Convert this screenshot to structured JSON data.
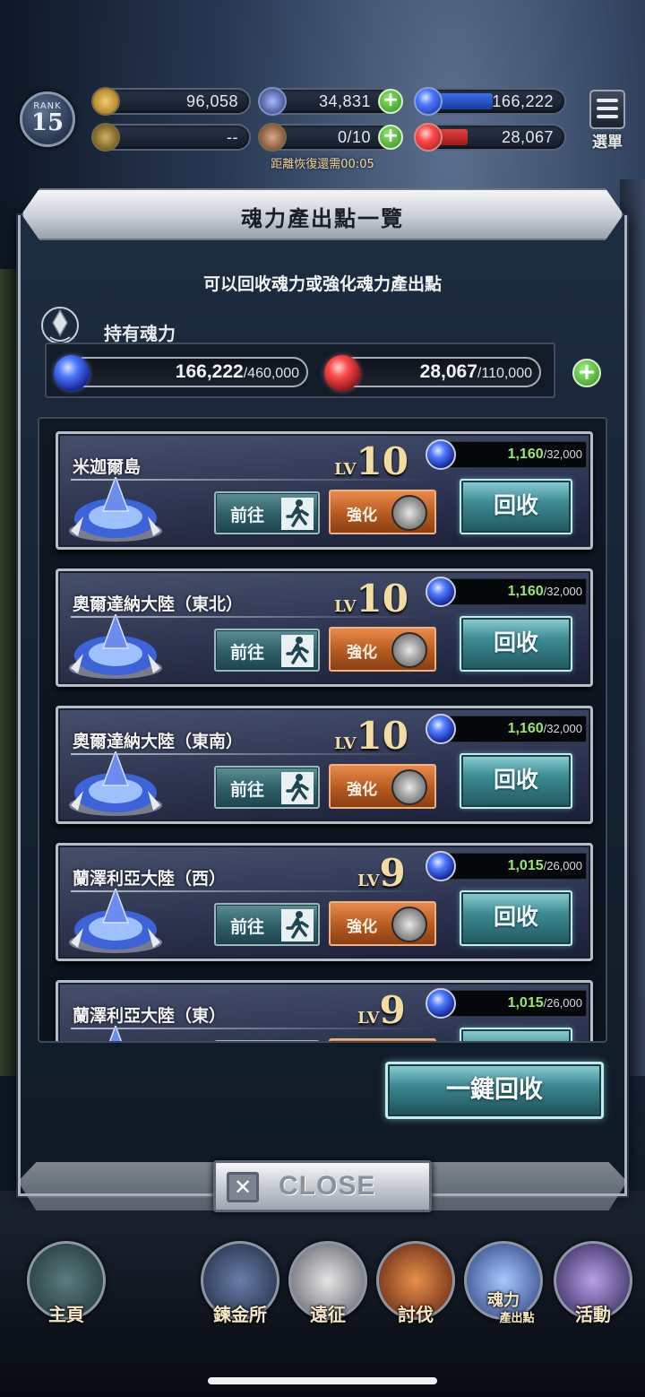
{
  "hud": {
    "rank_label": "RANK",
    "rank_value": "15",
    "gold": "96,058",
    "crystals": "34,831",
    "blue_soul": "166,222",
    "trophy": "--",
    "stamina": "0/10",
    "red_soul": "28,067",
    "recover_text": "距離恢復還需00:05",
    "menu_label": "選單"
  },
  "dialog": {
    "title": "魂力產出點一覽",
    "subtitle": "可以回收魂力或強化魂力產出點",
    "owned_label": "持有魂力",
    "blue_current": "166,222",
    "blue_max": "/460,000",
    "red_current": "28,067",
    "red_max": "/110,000",
    "collect_all_label": "一鍵回收",
    "close_label": "CLOSE"
  },
  "buttons": {
    "go": "前往",
    "upgrade": "強化",
    "collect": "回收",
    "lv": "LV"
  },
  "spots": [
    {
      "name": "米迦爾島",
      "level": "10",
      "current": "1,160",
      "max": "/32,000"
    },
    {
      "name": "奧爾達納大陸（東北）",
      "level": "10",
      "current": "1,160",
      "max": "/32,000"
    },
    {
      "name": "奧爾達納大陸（東南）",
      "level": "10",
      "current": "1,160",
      "max": "/32,000"
    },
    {
      "name": "蘭澤利亞大陸（西）",
      "level": "9",
      "current": "1,015",
      "max": "/26,000"
    },
    {
      "name": "蘭澤利亞大陸（東）",
      "level": "9",
      "current": "1,015",
      "max": "/26,000"
    }
  ],
  "nav": {
    "home": "主頁",
    "alchemy": "鍊金所",
    "expedition": "遠征",
    "subjugation": "討伐",
    "soul_spot": "魂力",
    "soul_spot_sub": "產出點",
    "events": "活動"
  },
  "colors": {
    "accent_teal": "#3e8c95",
    "upgrade_orange": "#b55a22",
    "progress_green": "#9ae86a",
    "level_gold": "#f2dca0"
  }
}
